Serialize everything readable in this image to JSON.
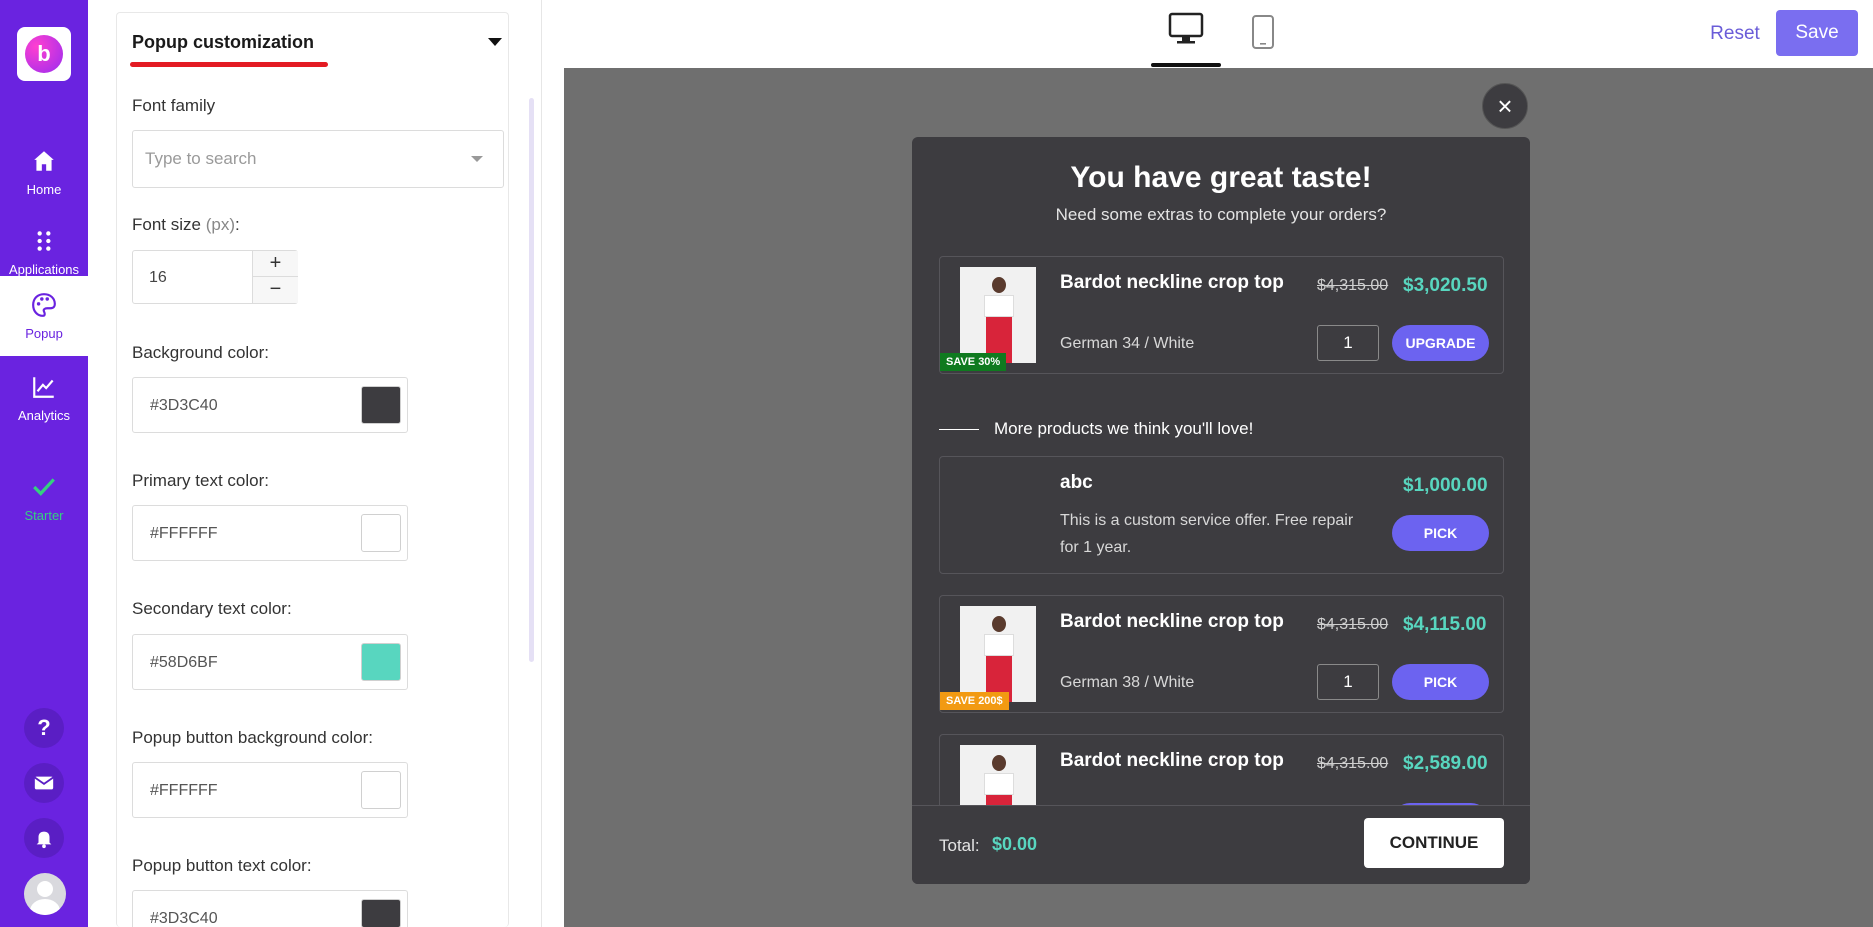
{
  "nav": {
    "items": [
      {
        "label": "Home",
        "icon": "home-icon"
      },
      {
        "label": "Applications",
        "icon": "apps-icon"
      },
      {
        "label": "Popup",
        "icon": "palette-icon"
      },
      {
        "label": "Analytics",
        "icon": "chart-icon"
      },
      {
        "label": "Starter",
        "icon": "check-icon"
      }
    ],
    "bottom": {
      "help": "?",
      "mail": "mail-icon",
      "bell": "bell-icon",
      "avatar": "avatar-icon"
    },
    "colors": {
      "background": "#6a23e0",
      "starter": "#35d07f"
    }
  },
  "settings": {
    "title": "Popup customization",
    "font_family": {
      "label": "Font family",
      "placeholder": "Type to search"
    },
    "font_size": {
      "label": "Font size",
      "unit": "(px)",
      "colon": ":",
      "value": "16",
      "plus": "+",
      "minus": "−"
    },
    "fields": [
      {
        "label": "Background color:",
        "value": "#3D3C40",
        "swatch": "#3D3C40"
      },
      {
        "label": "Primary text color:",
        "value": "#FFFFFF",
        "swatch": "#FFFFFF"
      },
      {
        "label": "Secondary text color:",
        "value": "#58D6BF",
        "swatch": "#58D6BF"
      },
      {
        "label": "Popup button background color:",
        "value": "#FFFFFF",
        "swatch": "#FFFFFF"
      },
      {
        "label": "Popup button text color:",
        "value": "#3D3C40",
        "swatch": "#3D3C40"
      }
    ]
  },
  "topbar": {
    "reset": "Reset",
    "save": "Save",
    "views": [
      "desktop-icon",
      "mobile-icon"
    ]
  },
  "popup": {
    "close": "×",
    "title": "You have great taste!",
    "subtitle": "Need some extras to complete your orders?",
    "main_product": {
      "name": "Bardot neckline crop top",
      "variant": "German 34 / White",
      "old_price": "$4,315.00",
      "price": "$3,020.50",
      "qty": "1",
      "button": "UPGRADE",
      "badge": "SAVE 30%"
    },
    "more_heading": "More products we think you'll love!",
    "offers": [
      {
        "name": "abc",
        "description": "This is a custom service offer. Free repair for 1 year.",
        "price": "$1,000.00",
        "button": "PICK"
      },
      {
        "name": "Bardot neckline crop top",
        "variant": "German 38 / White",
        "old_price": "$4,315.00",
        "price": "$4,115.00",
        "qty": "1",
        "button": "PICK",
        "badge": "SAVE 200$"
      },
      {
        "name": "Bardot neckline crop top",
        "old_price": "$4,315.00",
        "price": "$2,589.00"
      }
    ],
    "footer": {
      "total_label": "Total:",
      "total": "$0.00",
      "continue": "CONTINUE"
    },
    "colors": {
      "background": "#3D3C40",
      "secondary": "#58D6BF",
      "button": "#6c63f0"
    }
  }
}
